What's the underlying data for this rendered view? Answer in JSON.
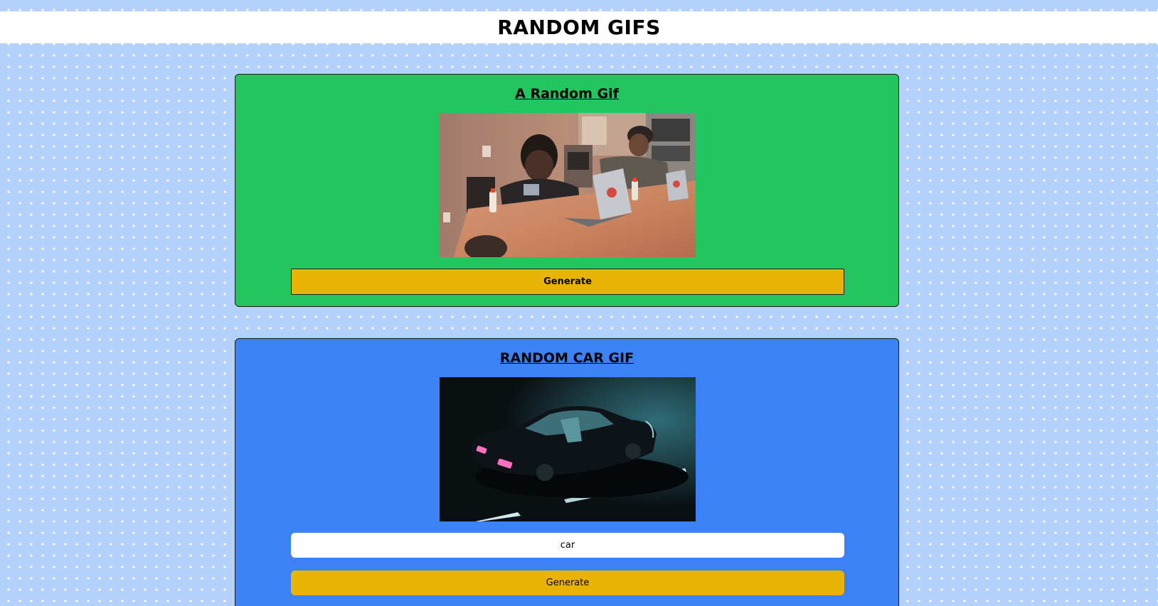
{
  "header": {
    "title": "RANDOM GIFS"
  },
  "random_card": {
    "title": "A Random Gif",
    "generate_label": "Generate",
    "background_color": "#22c55e"
  },
  "car_card": {
    "title": "RANDOM CAR GIF",
    "tag_input_value": "car",
    "generate_label": "Generate",
    "background_color": "#3b82f6"
  },
  "colors": {
    "page_background": "#b4d1fb",
    "button": "#eab308"
  }
}
